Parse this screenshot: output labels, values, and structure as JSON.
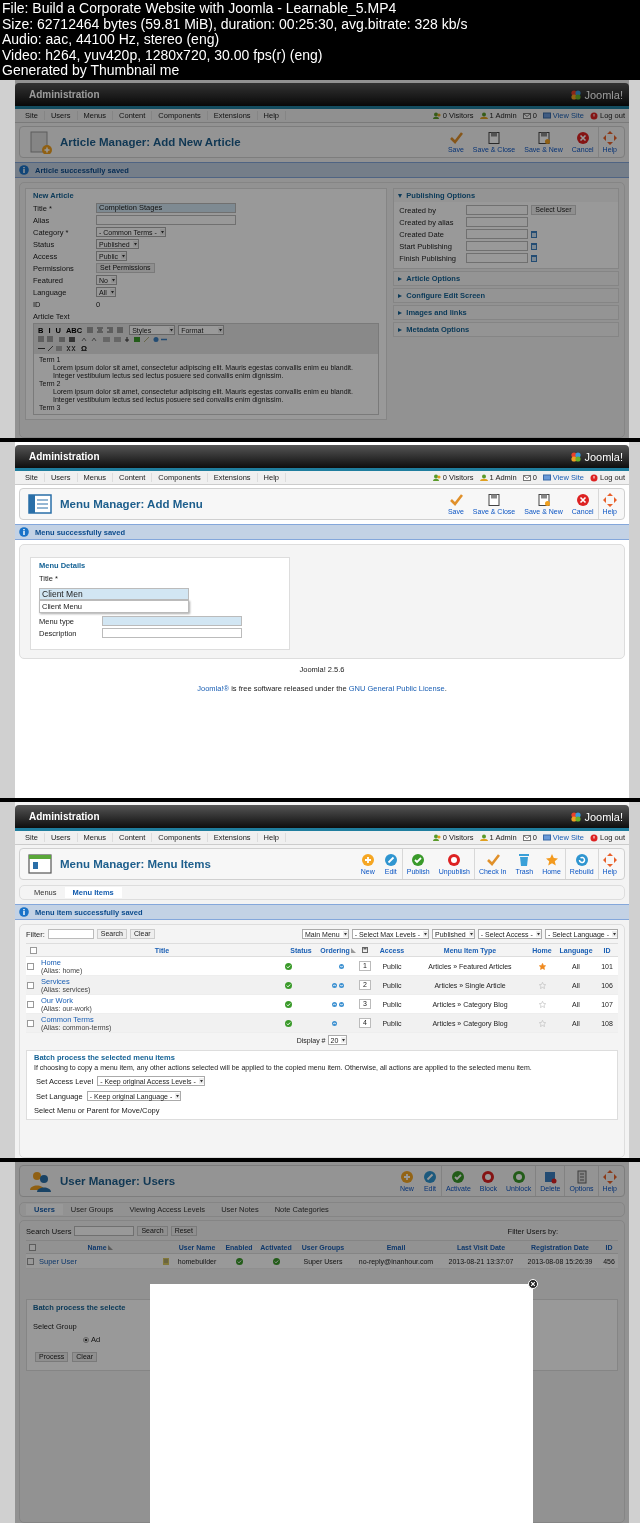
{
  "header_lines": [
    "File: Build a Corporate Website with Joomla - Learnable_5.MP4",
    "Size: 62712464 bytes (59.81 MiB), duration: 00:25:30, avg.bitrate: 328 kb/s",
    "Audio: aac, 44100 Hz, stereo (eng)",
    "Video: h264, yuv420p, 1280x720, 30.00 fps(r) (eng)",
    "Generated by Thumbnail me"
  ],
  "frames": [
    {
      "kind": "article_edit",
      "dimmed": true,
      "admin": {
        "title": "Administration",
        "logo": "Joomla!",
        "menu": [
          "Site",
          "Users",
          "Menus",
          "Content",
          "Components",
          "Extensions",
          "Help"
        ],
        "status": [
          {
            "kind": "visitors",
            "text": "0 Visitors"
          },
          {
            "kind": "admin",
            "text": "1 Admin"
          },
          {
            "kind": "messages",
            "text": "0"
          },
          {
            "kind": "view",
            "text": "View Site"
          },
          {
            "kind": "logout",
            "text": "Log out"
          }
        ]
      },
      "toolbar": {
        "title": "Article Manager: Add New Article",
        "buttons": [
          {
            "kind": "save",
            "label": "Save",
            "separated": false
          },
          {
            "kind": "save_close",
            "label": "Save & Close",
            "separated": false
          },
          {
            "kind": "save_new",
            "label": "Save & New",
            "separated": false
          },
          {
            "kind": "cancel",
            "label": "Cancel",
            "separated": false
          },
          {
            "kind": "help",
            "label": "Help",
            "separated": true
          }
        ]
      },
      "message": "Article successfully saved",
      "form": {
        "legend": "New Article",
        "fields": [
          {
            "label": "Title *",
            "kind": "text",
            "value": "Completion Stages",
            "focused": true
          },
          {
            "label": "Alias",
            "kind": "text",
            "focused": false
          },
          {
            "label": "Category *",
            "kind": "select",
            "value": "- Common Terms -"
          },
          {
            "label": "Status",
            "kind": "select",
            "value": "Published"
          },
          {
            "label": "Access",
            "kind": "select",
            "value": "Public"
          },
          {
            "label": "Permissions",
            "kind": "button",
            "value": "Set Permissions"
          },
          {
            "label": "Featured",
            "kind": "select",
            "value": "No"
          },
          {
            "label": "Language",
            "kind": "select",
            "value": "All"
          },
          {
            "label": "ID",
            "kind": "plain",
            "value": "0"
          },
          {
            "label": "Article Text",
            "kind": "none"
          }
        ]
      },
      "editor": {
        "buttons": [
          "B",
          "I",
          "U",
          "ABC"
        ],
        "styles": "Styles",
        "format": "Format",
        "special": "Ω",
        "content": [
          {
            "kind": "term",
            "text": "Term 1"
          },
          {
            "kind": "para",
            "text": "Lorem ipsum dolor sit amet, consectetur adipiscing elit. Mauris egestas convallis enim eu blandit. Integer vestibulum lectus sed lectus posuere sed convallis enim dignissim."
          },
          {
            "kind": "term",
            "text": "Term 2"
          },
          {
            "kind": "para",
            "text": "Lorem ipsum dolor sit amet, consectetur adipiscing elit. Mauris egestas convallis enim eu blandit. Integer vestibulum lectus sed lectus posuere sed convallis enim dignissim."
          },
          {
            "kind": "term",
            "text": "Term 3"
          }
        ]
      },
      "panels": [
        {
          "title": "Publishing Options",
          "expanded": true,
          "fields": [
            {
              "label": "Created by",
              "kind": "text_button",
              "value": "Select User",
              "focused": false
            },
            {
              "label": "Created by alias",
              "kind": "text",
              "focused": false
            },
            {
              "label": "Created Date",
              "kind": "date",
              "focused": false
            },
            {
              "label": "Start Publishing",
              "kind": "date",
              "focused": false
            },
            {
              "label": "Finish Publishing",
              "kind": "date",
              "focused": false
            }
          ]
        },
        {
          "title": "Article Options",
          "expanded": false
        },
        {
          "title": "Configure Edit Screen",
          "expanded": false
        },
        {
          "title": "Images and links",
          "expanded": false
        },
        {
          "title": "Metadata Options",
          "expanded": false
        }
      ]
    },
    {
      "kind": "menu_edit",
      "dimmed": false,
      "admin": {
        "title": "Administration",
        "logo": "Joomla!",
        "menu": [
          "Site",
          "Users",
          "Menus",
          "Content",
          "Components",
          "Extensions",
          "Help"
        ],
        "status": [
          {
            "kind": "visitors",
            "text": "0 Visitors"
          },
          {
            "kind": "admin",
            "text": "1 Admin"
          },
          {
            "kind": "messages",
            "text": "0"
          },
          {
            "kind": "view",
            "text": "View Site"
          },
          {
            "kind": "logout",
            "text": "Log out"
          }
        ]
      },
      "toolbar": {
        "title": "Menu Manager: Add Menu",
        "buttons": [
          {
            "kind": "save",
            "label": "Save",
            "separated": false
          },
          {
            "kind": "save_close",
            "label": "Save & Close",
            "separated": false
          },
          {
            "kind": "save_new",
            "label": "Save & New",
            "separated": false
          },
          {
            "kind": "cancel",
            "label": "Cancel",
            "separated": false
          },
          {
            "kind": "help",
            "label": "Help",
            "separated": true
          }
        ]
      },
      "message": "Menu successfully saved",
      "form": {
        "legend": "Menu Details",
        "title_label": "Title *",
        "title_value": "Client Men",
        "suggestions": [
          "Client Menu"
        ],
        "fields": [
          {
            "label": "Menu type",
            "kind": "text",
            "focused": true
          },
          {
            "label": "Description",
            "kind": "text",
            "focused": false
          }
        ]
      },
      "footer": {
        "version": "Joomla! 2.5.6",
        "license": {
          "first_link": "Joomla!®",
          "middle": " is free software released under the ",
          "second_link": "GNU General Public License",
          "end": "."
        }
      }
    },
    {
      "kind": "menu_items",
      "dimmed": false,
      "admin": {
        "title": "Administration",
        "logo": "Joomla!",
        "menu": [
          "Site",
          "Users",
          "Menus",
          "Content",
          "Components",
          "Extensions",
          "Help"
        ],
        "status": [
          {
            "kind": "visitors",
            "text": "0 Visitors"
          },
          {
            "kind": "admin",
            "text": "1 Admin"
          },
          {
            "kind": "messages",
            "text": "0"
          },
          {
            "kind": "view",
            "text": "View Site"
          },
          {
            "kind": "logout",
            "text": "Log out"
          }
        ]
      },
      "toolbar": {
        "title": "Menu Manager: Menu Items",
        "buttons": [
          {
            "kind": "new",
            "label": "New",
            "separated": false
          },
          {
            "kind": "edit",
            "label": "Edit",
            "separated": false
          },
          {
            "kind": "publish",
            "label": "Publish",
            "separated": true
          },
          {
            "kind": "unpublish",
            "label": "Unpublish",
            "separated": false
          },
          {
            "kind": "checkin",
            "label": "Check In",
            "separated": true
          },
          {
            "kind": "trash",
            "label": "Trash",
            "separated": false
          },
          {
            "kind": "home",
            "label": "Home",
            "separated": false
          },
          {
            "kind": "rebuild",
            "label": "Rebuild",
            "separated": true
          },
          {
            "kind": "help",
            "label": "Help",
            "separated": true
          }
        ]
      },
      "tabs": [
        {
          "label": "Menus",
          "selected": false
        },
        {
          "label": "Menu Items",
          "selected": true
        }
      ],
      "message": "Menu item successfully saved",
      "filter": {
        "label": "Filter:",
        "buttons": [
          "Search",
          "Clear"
        ],
        "selects": [
          "Main Menu",
          "- Select Max Levels -",
          "Published",
          "- Select Access -",
          "- Select Language -"
        ]
      },
      "table": {
        "columns": [
          {
            "kind": "checkbox",
            "checked": false
          },
          {
            "kind": "text",
            "label": "Title",
            "sorted": false
          },
          {
            "kind": "text",
            "label": "Status",
            "sorted": false
          },
          {
            "kind": "text",
            "label": "Ordering",
            "sorted": true
          },
          {
            "kind": "icon"
          },
          {
            "kind": "text",
            "label": "Access",
            "sorted": false
          },
          {
            "kind": "text",
            "label": "Menu Item Type",
            "sorted": false
          },
          {
            "kind": "text",
            "label": "Home",
            "sorted": false
          },
          {
            "kind": "text",
            "label": "Language",
            "sorted": false
          },
          {
            "kind": "text",
            "label": "ID",
            "sorted": false
          }
        ],
        "rows": [
          {
            "checked": false,
            "title": "Home",
            "alias": "(Alias: home)",
            "published": true,
            "order_up": false,
            "order_down": true,
            "order": "1",
            "access": "Public",
            "type": "Articles » Featured Articles",
            "home": true,
            "language": "All",
            "id": "101"
          },
          {
            "checked": false,
            "title": "Services",
            "alias": "(Alias: services)",
            "published": true,
            "order_up": true,
            "order_down": true,
            "order": "2",
            "access": "Public",
            "type": "Articles » Single Article",
            "home": false,
            "language": "All",
            "id": "106"
          },
          {
            "checked": false,
            "title": "Our Work",
            "alias": "(Alias: our-work)",
            "published": true,
            "order_up": true,
            "order_down": true,
            "order": "3",
            "access": "Public",
            "type": "Articles » Category Blog",
            "home": false,
            "language": "All",
            "id": "107"
          },
          {
            "checked": false,
            "title": "Common Terms",
            "alias": "(Alias: common-terms)",
            "published": true,
            "order_up": true,
            "order_down": false,
            "order": "4",
            "access": "Public",
            "type": "Articles » Category Blog",
            "home": false,
            "language": "All",
            "id": "108"
          }
        ]
      },
      "display": {
        "label": "Display #",
        "value": "20"
      },
      "batch": {
        "legend": "Batch process the selected menu items",
        "note": "If choosing to copy a menu item, any other actions selected will be applied to the copied menu item. Otherwise, all actions are applied to the selected menu item.",
        "fields": [
          {
            "label": "Set Access Level",
            "value": "- Keep original Access Levels -"
          },
          {
            "label": "Set Language",
            "value": "- Keep original Language -"
          }
        ],
        "move_label": "Select Menu or Parent for Move/Copy"
      }
    },
    {
      "kind": "users",
      "dimmed": true,
      "toolbar": {
        "title": "User Manager: Users",
        "buttons": [
          {
            "kind": "new",
            "label": "New",
            "separated": false
          },
          {
            "kind": "edit",
            "label": "Edit",
            "separated": false
          },
          {
            "kind": "activate",
            "label": "Activate",
            "separated": true
          },
          {
            "kind": "block",
            "label": "Block",
            "separated": false
          },
          {
            "kind": "unblock",
            "label": "Unblock",
            "separated": false
          },
          {
            "kind": "delete",
            "label": "Delete",
            "separated": true
          },
          {
            "kind": "options",
            "label": "Options",
            "separated": true
          },
          {
            "kind": "help",
            "label": "Help",
            "separated": true
          }
        ]
      },
      "tabs": [
        {
          "label": "Users",
          "selected": true
        },
        {
          "label": "User Groups",
          "selected": false
        },
        {
          "label": "Viewing Access Levels",
          "selected": false
        },
        {
          "label": "User Notes",
          "selected": false
        },
        {
          "label": "Note Categories",
          "selected": false
        }
      ],
      "search": {
        "label": "Search Users",
        "buttons": [
          "Search",
          "Reset"
        ],
        "filter_label": "Filter Users by:"
      },
      "table": {
        "columns": [
          {
            "kind": "checkbox",
            "checked": false
          },
          {
            "kind": "text",
            "label": "Name",
            "sorted": true
          },
          {
            "kind": "blank"
          },
          {
            "kind": "text",
            "label": "User Name",
            "sorted": false
          },
          {
            "kind": "text",
            "label": "Enabled",
            "sorted": false
          },
          {
            "kind": "text",
            "label": "Activated",
            "sorted": false
          },
          {
            "kind": "text",
            "label": "User Groups",
            "sorted": false
          },
          {
            "kind": "text",
            "label": "Email",
            "sorted": false
          },
          {
            "kind": "text",
            "label": "Last Visit Date",
            "sorted": false
          },
          {
            "kind": "text",
            "label": "Registration Date",
            "sorted": false
          },
          {
            "kind": "text",
            "label": "ID",
            "sorted": false
          }
        ],
        "rows": [
          {
            "checked": false,
            "name": "Super User",
            "user_name": "homebuilder",
            "enabled": true,
            "activated": true,
            "groups": "Super Users",
            "email": "no-reply@inanhour.com",
            "last_visit": "2013-08-21 13:37:07",
            "registered": "2013-08-08 15:26:39",
            "id": "456"
          }
        ]
      },
      "batch": {
        "legend": "Batch process the selecte",
        "group_label": "Select Group",
        "radio": {
          "label": "Ad",
          "selected": true
        },
        "buttons": [
          "Process",
          "Clear"
        ]
      },
      "modal": {
        "open": true
      }
    }
  ]
}
